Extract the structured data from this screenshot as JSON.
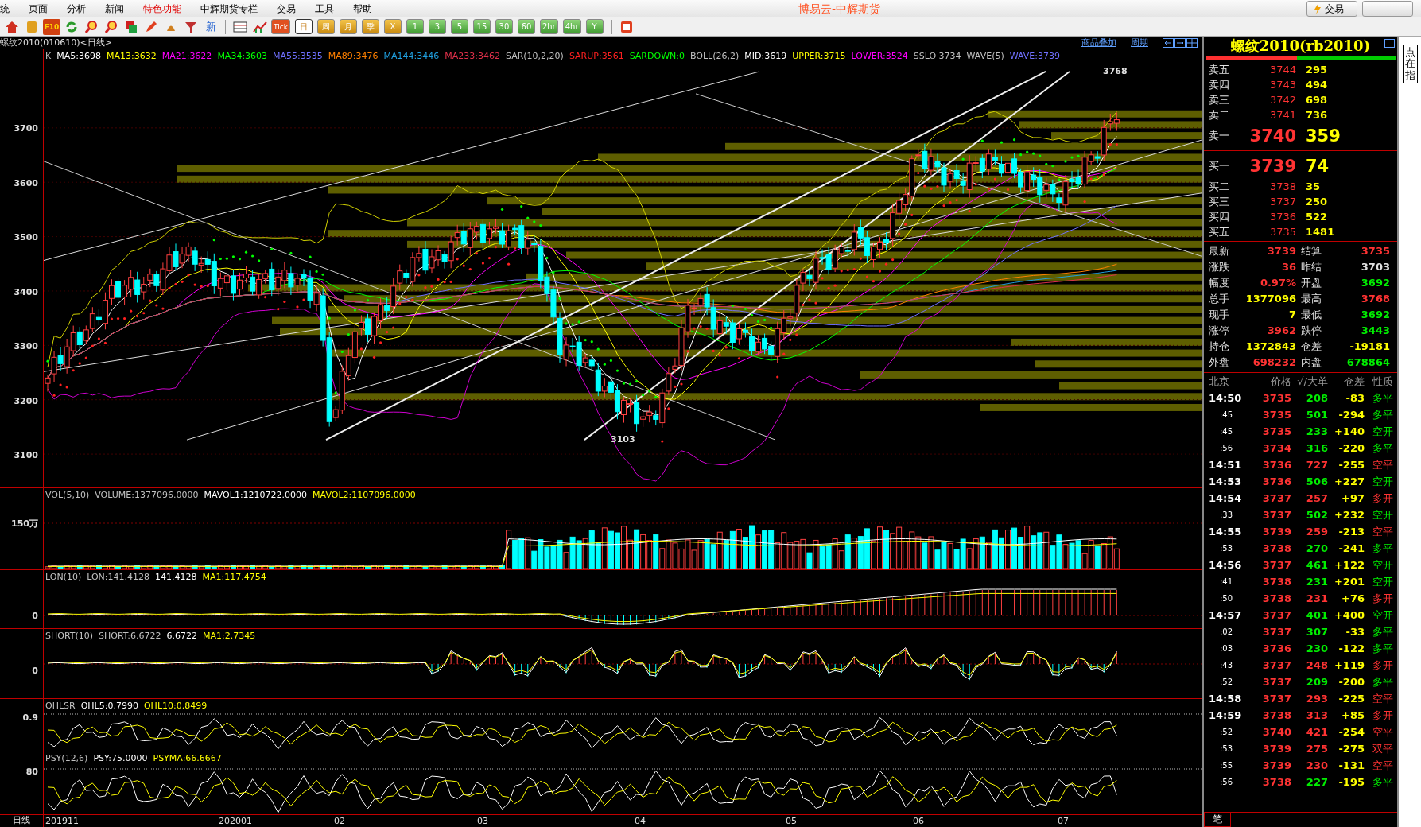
{
  "menu": {
    "items": [
      {
        "label": "统",
        "highlighted": false
      },
      {
        "label": "页面",
        "highlighted": false
      },
      {
        "label": "分析",
        "highlighted": false
      },
      {
        "label": "新闻",
        "highlighted": false
      },
      {
        "label": "特色功能",
        "highlighted": true
      },
      {
        "label": "中辉期货专栏",
        "highlighted": false
      },
      {
        "label": "交易",
        "highlighted": false
      },
      {
        "label": "工具",
        "highlighted": false
      },
      {
        "label": "帮助",
        "highlighted": false
      }
    ]
  },
  "window": {
    "title": "博易云-中辉期货",
    "buttons": [
      {
        "label": "交易"
      }
    ]
  },
  "toolbar": {
    "icon_labels": [
      "F10",
      "新"
    ],
    "periods": [
      {
        "label": "Tick",
        "selected": false
      },
      {
        "label": "日",
        "selected": true
      },
      {
        "label": "周",
        "selected": false
      },
      {
        "label": "月",
        "selected": false
      },
      {
        "label": "季",
        "selected": false
      },
      {
        "label": "X",
        "selected": false
      },
      {
        "label": "1",
        "selected": false
      },
      {
        "label": "3",
        "selected": false
      },
      {
        "label": "5",
        "selected": false
      },
      {
        "label": "15",
        "selected": false
      },
      {
        "label": "30",
        "selected": false
      },
      {
        "label": "60",
        "selected": false
      },
      {
        "label": "2hr",
        "selected": false
      },
      {
        "label": "4hr",
        "selected": false
      },
      {
        "label": "Y",
        "selected": false
      }
    ]
  },
  "chart_header": {
    "title": "螺纹2010(010610)<日线>",
    "links": [
      "商品叠加",
      "周期"
    ]
  },
  "main_chart": {
    "indicators": [
      {
        "text": "K",
        "color": "#c0c0c0"
      },
      {
        "text": "MA5:3698",
        "color": "#ffffff"
      },
      {
        "text": "MA13:3632",
        "color": "#ffff00"
      },
      {
        "text": "MA21:3622",
        "color": "#ff00ff"
      },
      {
        "text": "MA34:3603",
        "color": "#00ff00"
      },
      {
        "text": "MA55:3535",
        "color": "#7070ff"
      },
      {
        "text": "MA89:3476",
        "color": "#ff8000"
      },
      {
        "text": "MA144:3446",
        "color": "#20a0e0"
      },
      {
        "text": "MA233:3462",
        "color": "#e0304a"
      },
      {
        "text": "SAR(10,2,20)",
        "color": "#c0c0c0"
      },
      {
        "text": "SARUP:3561",
        "color": "#ff2020"
      },
      {
        "text": "SARDOWN:0",
        "color": "#00ff00"
      },
      {
        "text": "BOLL(26,2)",
        "color": "#c0c0c0"
      },
      {
        "text": "MID:3619",
        "color": "#ffffff"
      },
      {
        "text": "UPPER:3715",
        "color": "#ffff00"
      },
      {
        "text": "LOWER:3524",
        "color": "#ff00ff"
      },
      {
        "text": "SSLO 3734",
        "color": "#c0c0c0"
      },
      {
        "text": "WAVE(5)",
        "color": "#c0c0c0"
      },
      {
        "text": "WAVE:3739",
        "color": "#7070ff"
      }
    ],
    "y_labels": [
      "3700",
      "3600",
      "3500",
      "3400",
      "3300",
      "3200",
      "3100"
    ],
    "annotations": [
      {
        "text": "3768"
      },
      {
        "text": "3103"
      }
    ]
  },
  "subcharts": [
    {
      "kind": "volume",
      "y_label": "150万",
      "indicators": [
        {
          "text": "VOL(5,10)",
          "color": "#c0c0c0"
        },
        {
          "text": "VOLUME:1377096.0000",
          "color": "#c0c0c0"
        },
        {
          "text": "MAVOL1:1210722.0000",
          "color": "#ffffff"
        },
        {
          "text": "MAVOL2:1107096.0000",
          "color": "#ffff00"
        }
      ]
    },
    {
      "kind": "lon",
      "y_label": "0",
      "indicators": [
        {
          "text": "LON(10)",
          "color": "#c0c0c0"
        },
        {
          "text": "LON:141.4128",
          "color": "#c0c0c0"
        },
        {
          "text": "141.4128",
          "color": "#ffffff"
        },
        {
          "text": "MA1:117.4754",
          "color": "#ffff00"
        }
      ]
    },
    {
      "kind": "short",
      "y_label": "0",
      "indicators": [
        {
          "text": "SHORT(10)",
          "color": "#c0c0c0"
        },
        {
          "text": "SHORT:6.6722",
          "color": "#c0c0c0"
        },
        {
          "text": "6.6722",
          "color": "#ffffff"
        },
        {
          "text": "MA1:2.7345",
          "color": "#ffff00"
        }
      ]
    },
    {
      "kind": "qhlsr",
      "y_label": "0.9",
      "indicators": [
        {
          "text": "QHLSR",
          "color": "#c0c0c0"
        },
        {
          "text": "QHL5:0.7990",
          "color": "#ffffff"
        },
        {
          "text": "QHL10:0.8499",
          "color": "#ffff00"
        }
      ]
    },
    {
      "kind": "psy",
      "y_label": "80",
      "indicators": [
        {
          "text": "PSY(12,6)",
          "color": "#c0c0c0"
        },
        {
          "text": "PSY:75.0000",
          "color": "#ffffff"
        },
        {
          "text": "PSYMA:66.6667",
          "color": "#ffff00"
        }
      ]
    }
  ],
  "x_axis": {
    "label": "日线",
    "ticks": [
      "201911",
      "202001",
      "02",
      "03",
      "04",
      "05",
      "06",
      "07"
    ]
  },
  "quote": {
    "title": "螺纹2010(rb2010)",
    "ratio": {
      "level": 0.48
    },
    "asks": [
      {
        "label": "卖五",
        "price": "3744",
        "volume": "295"
      },
      {
        "label": "卖四",
        "price": "3743",
        "volume": "494"
      },
      {
        "label": "卖三",
        "price": "3742",
        "volume": "698"
      },
      {
        "label": "卖二",
        "price": "3741",
        "volume": "736"
      },
      {
        "label": "卖一",
        "price": "3740",
        "volume": "359"
      }
    ],
    "bids": [
      {
        "label": "买一",
        "price": "3739",
        "volume": "74"
      },
      {
        "label": "买二",
        "price": "3738",
        "volume": "35"
      },
      {
        "label": "买三",
        "price": "3737",
        "volume": "250"
      },
      {
        "label": "买四",
        "price": "3736",
        "volume": "522"
      },
      {
        "label": "买五",
        "price": "3735",
        "volume": "1481"
      }
    ],
    "stats": [
      {
        "label": "最新",
        "value": "3739",
        "color": "#ff3333"
      },
      {
        "label": "结算",
        "value": "3735",
        "color": "#ff3333"
      },
      {
        "label": "涨跌",
        "value": "36",
        "color": "#ff3333"
      },
      {
        "label": "昨结",
        "value": "3703",
        "color": "#e0e0e0"
      },
      {
        "label": "幅度",
        "value": "0.97%",
        "color": "#ff3333"
      },
      {
        "label": "开盘",
        "value": "3692",
        "color": "#00ee00"
      },
      {
        "label": "总手",
        "value": "1377096",
        "color": "#ffff00"
      },
      {
        "label": "最高",
        "value": "3768",
        "color": "#ff3333"
      },
      {
        "label": "现手",
        "value": "7",
        "color": "#ffff00"
      },
      {
        "label": "最低",
        "value": "3692",
        "color": "#00ee00"
      },
      {
        "label": "涨停",
        "value": "3962",
        "color": "#ff3333"
      },
      {
        "label": "跌停",
        "value": "3443",
        "color": "#00ee00"
      },
      {
        "label": "持仓",
        "value": "1372843",
        "color": "#ffff00"
      },
      {
        "label": "仓差",
        "value": "-19181",
        "color": "#ffff00"
      },
      {
        "label": "外盘",
        "value": "698232",
        "color": "#ff3333"
      },
      {
        "label": "内盘",
        "value": "678864",
        "color": "#00ee00"
      }
    ],
    "trade_columns": [
      "北京",
      "价格",
      "√/大单",
      "仓差",
      "性质"
    ],
    "trades": [
      {
        "time": "14:50",
        "kind": "minute",
        "price": "3735",
        "volume": "208",
        "oi": "-83",
        "nature": "多平",
        "color": "#00ee00"
      },
      {
        "time": ":45",
        "kind": "second",
        "price": "3735",
        "volume": "501",
        "oi": "-294",
        "nature": "多平",
        "color": "#00ee00"
      },
      {
        "time": ":45",
        "kind": "second",
        "price": "3735",
        "volume": "233",
        "oi": "+140",
        "nature": "空开",
        "color": "#00ee00"
      },
      {
        "time": ":56",
        "kind": "second",
        "price": "3734",
        "volume": "316",
        "oi": "-220",
        "nature": "多平",
        "color": "#00ee00"
      },
      {
        "time": "14:51",
        "kind": "minute",
        "price": "3736",
        "volume": "727",
        "oi": "-255",
        "nature": "空平",
        "color": "#ff3333"
      },
      {
        "time": "14:53",
        "kind": "minute",
        "price": "3736",
        "volume": "506",
        "oi": "+227",
        "nature": "空开",
        "color": "#00ee00"
      },
      {
        "time": "14:54",
        "kind": "minute",
        "price": "3737",
        "volume": "257",
        "oi": "+97",
        "nature": "多开",
        "color": "#ff3333"
      },
      {
        "time": ":33",
        "kind": "second",
        "price": "3737",
        "volume": "502",
        "oi": "+232",
        "nature": "空开",
        "color": "#00ee00"
      },
      {
        "time": "14:55",
        "kind": "minute",
        "price": "3739",
        "volume": "259",
        "oi": "-213",
        "nature": "空平",
        "color": "#ff3333"
      },
      {
        "time": ":53",
        "kind": "second",
        "price": "3738",
        "volume": "270",
        "oi": "-241",
        "nature": "多平",
        "color": "#00ee00"
      },
      {
        "time": "14:56",
        "kind": "minute",
        "price": "3737",
        "volume": "461",
        "oi": "+122",
        "nature": "空开",
        "color": "#00ee00"
      },
      {
        "time": ":41",
        "kind": "second",
        "price": "3738",
        "volume": "231",
        "oi": "+201",
        "nature": "空开",
        "color": "#00ee00"
      },
      {
        "time": ":50",
        "kind": "second",
        "price": "3738",
        "volume": "231",
        "oi": "+76",
        "nature": "多开",
        "color": "#ff3333"
      },
      {
        "time": "14:57",
        "kind": "minute",
        "price": "3737",
        "volume": "401",
        "oi": "+400",
        "nature": "空开",
        "color": "#00ee00"
      },
      {
        "time": ":02",
        "kind": "second",
        "price": "3737",
        "volume": "307",
        "oi": "-33",
        "nature": "多平",
        "color": "#00ee00"
      },
      {
        "time": ":03",
        "kind": "second",
        "price": "3736",
        "volume": "230",
        "oi": "-122",
        "nature": "多平",
        "color": "#00ee00"
      },
      {
        "time": ":43",
        "kind": "second",
        "price": "3737",
        "volume": "248",
        "oi": "+119",
        "nature": "多开",
        "color": "#ff3333"
      },
      {
        "time": ":52",
        "kind": "second",
        "price": "3737",
        "volume": "209",
        "oi": "-200",
        "nature": "多平",
        "color": "#00ee00"
      },
      {
        "time": "14:58",
        "kind": "minute",
        "price": "3737",
        "volume": "293",
        "oi": "-225",
        "nature": "空平",
        "color": "#ff3333"
      },
      {
        "time": "14:59",
        "kind": "minute",
        "price": "3738",
        "volume": "313",
        "oi": "+85",
        "nature": "多开",
        "color": "#ff3333"
      },
      {
        "time": ":52",
        "kind": "second",
        "price": "3740",
        "volume": "421",
        "oi": "-254",
        "nature": "空平",
        "color": "#ff3333"
      },
      {
        "time": ":53",
        "kind": "second",
        "price": "3739",
        "volume": "275",
        "oi": "-275",
        "nature": "双平",
        "color": "#ff3333"
      },
      {
        "time": ":55",
        "kind": "second",
        "price": "3739",
        "volume": "230",
        "oi": "-131",
        "nature": "空平",
        "color": "#ff3333"
      },
      {
        "time": ":56",
        "kind": "second",
        "price": "3738",
        "volume": "227",
        "oi": "-195",
        "nature": "多平",
        "color": "#00ee00"
      }
    ],
    "tab": "笔"
  },
  "side_tab": {
    "label": "点在指"
  }
}
